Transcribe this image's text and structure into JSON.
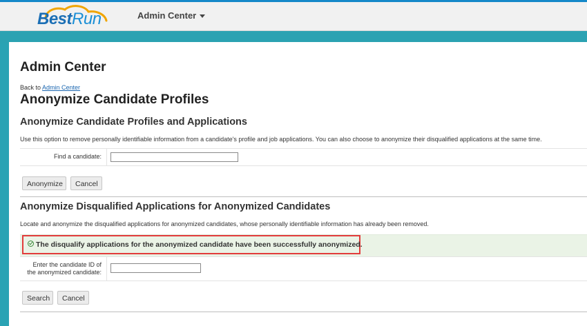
{
  "header": {
    "logo_best": "Best",
    "logo_run": "Run",
    "admin_menu_label": "Admin Center"
  },
  "page": {
    "title": "Admin Center",
    "back_prefix": "Back to",
    "back_link": "Admin Center",
    "section_title": "Anonymize Candidate Profiles"
  },
  "anonymize_profiles": {
    "heading": "Anonymize Candidate Profiles and Applications",
    "description": "Use this option to remove personally identifiable information from a candidate's profile and job applications. You can also choose to anonymize their disqualified applications at the same time.",
    "find_label": "Find a candidate:",
    "find_value": "",
    "anonymize_button": "Anonymize",
    "cancel_button": "Cancel"
  },
  "disqualified": {
    "heading": "Anonymize Disqualified Applications for Anonymized Candidates",
    "description": "Locate and anonymize the disqualified applications for anonymized candidates, whose personally identifiable information has already been removed.",
    "success_message": "The disqualify applications for the anonymized candidate have been successfully anonymized.",
    "candidate_id_label_line1": "Enter the candidate ID of",
    "candidate_id_label_line2": "the anonymized candidate:",
    "candidate_id_value": "",
    "search_button": "Search",
    "cancel_button": "Cancel"
  },
  "colors": {
    "accent_teal": "#2aa3b4",
    "brand_blue": "#1b6fb5",
    "success_bg": "#eaf3e6",
    "highlight_red": "#e23b3b"
  }
}
